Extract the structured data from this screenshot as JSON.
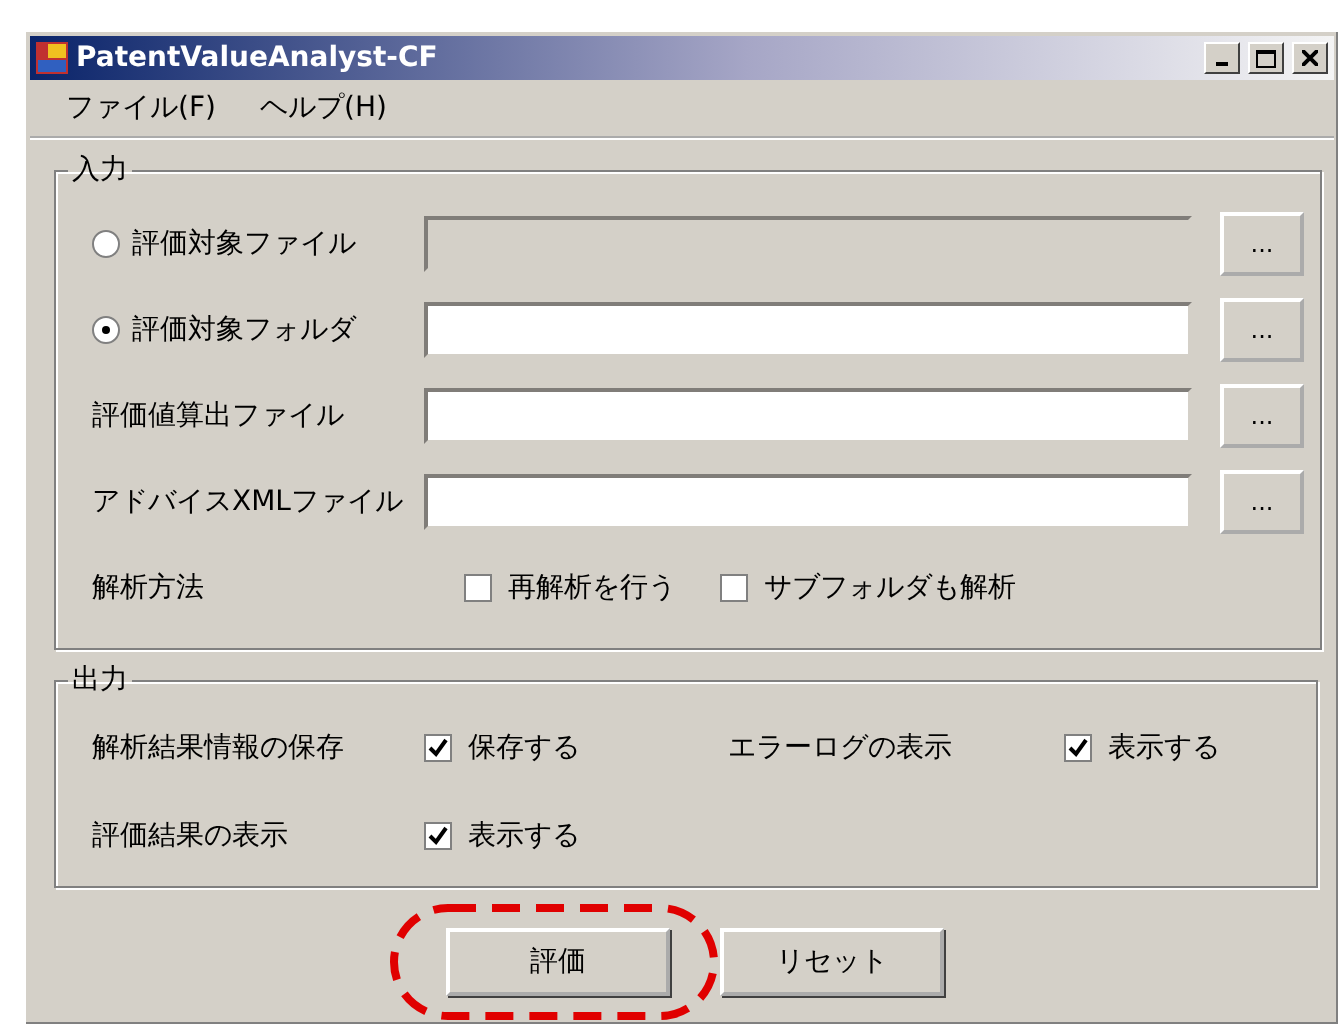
{
  "window": {
    "title": "PatentValueAnalyst-CF"
  },
  "menu": [
    {
      "label": "ファイル(F)"
    },
    {
      "label": "ヘルプ(H)"
    }
  ],
  "input_group": {
    "title": "入力",
    "rows": [
      {
        "kind": "radio",
        "label": "評価対象ファイル",
        "selected": false,
        "disabled": true,
        "browse": "..."
      },
      {
        "kind": "radio",
        "label": "評価対象フォルダ",
        "selected": true,
        "disabled": false,
        "browse": "..."
      },
      {
        "kind": "plain",
        "label": "評価値算出ファイル",
        "disabled": false,
        "browse": "..."
      },
      {
        "kind": "plain",
        "label": "アドバイスXMLファイル",
        "disabled": false,
        "browse": "..."
      }
    ],
    "method": {
      "label": "解析方法",
      "options": [
        {
          "label": "再解析を行う",
          "checked": false
        },
        {
          "label": "サブフォルダも解析",
          "checked": false
        }
      ]
    }
  },
  "output_group": {
    "title": "出力",
    "items": [
      {
        "label": "解析結果情報の保存",
        "option": "保存する",
        "checked": true
      },
      {
        "label": "エラーログの表示",
        "option": "表示する",
        "checked": true
      },
      {
        "label": "評価結果の表示",
        "option": "表示する",
        "checked": true
      }
    ]
  },
  "buttons": [
    {
      "label": "評価",
      "highlighted": true
    },
    {
      "label": "リセット",
      "highlighted": false
    }
  ]
}
